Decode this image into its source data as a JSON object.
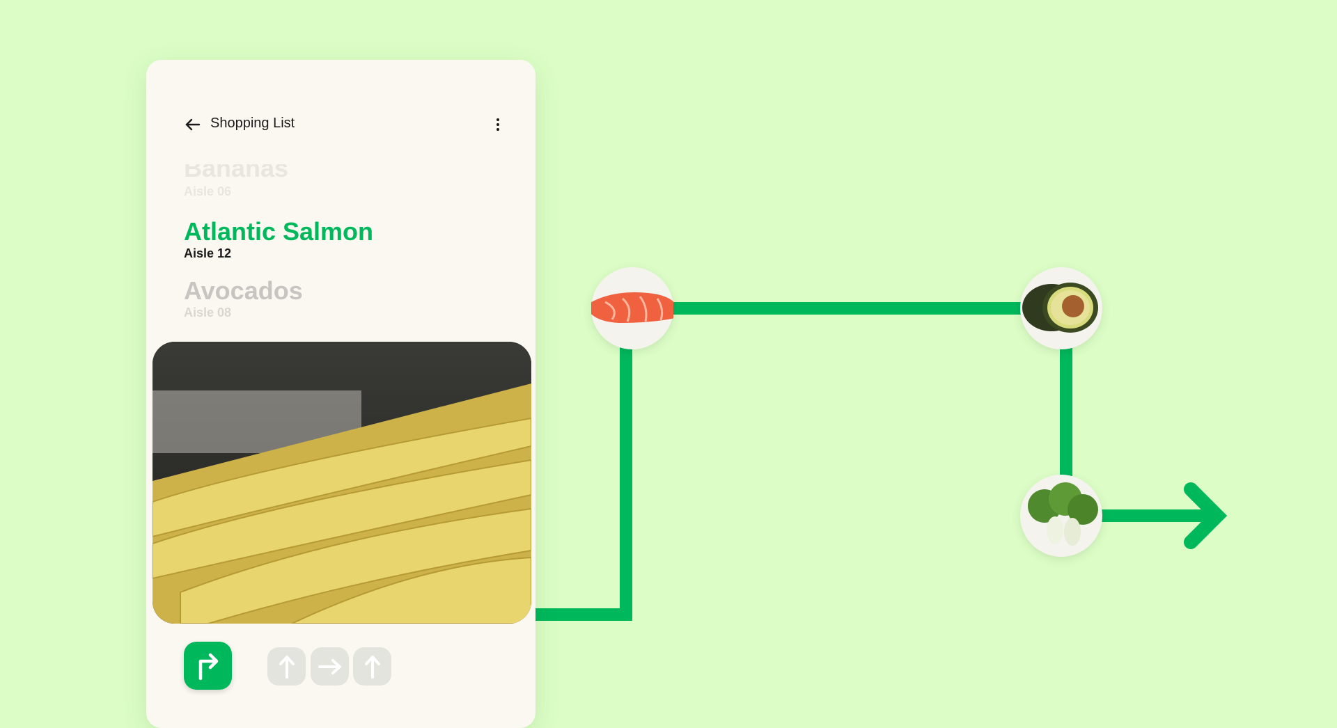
{
  "header": {
    "title": "Shopping List",
    "back_icon": "arrow-left-icon",
    "menu_icon": "more-vertical-icon"
  },
  "items": [
    {
      "name": "Bananas",
      "aisle": "Aisle 06",
      "state": "previous"
    },
    {
      "name": "Atlantic Salmon",
      "aisle": "Aisle 12",
      "state": "current"
    },
    {
      "name": "Avocados",
      "aisle": "Aisle 08",
      "state": "next"
    }
  ],
  "directions": {
    "current": "turn-right-icon",
    "upcoming": [
      "arrow-up-icon",
      "arrow-right-icon",
      "arrow-up-icon"
    ]
  },
  "route": {
    "stops": [
      "salmon",
      "avocado",
      "bok-choy"
    ]
  },
  "colors": {
    "accent": "#00b85c",
    "background": "#dcfec6",
    "card": "#fbf8f1"
  }
}
